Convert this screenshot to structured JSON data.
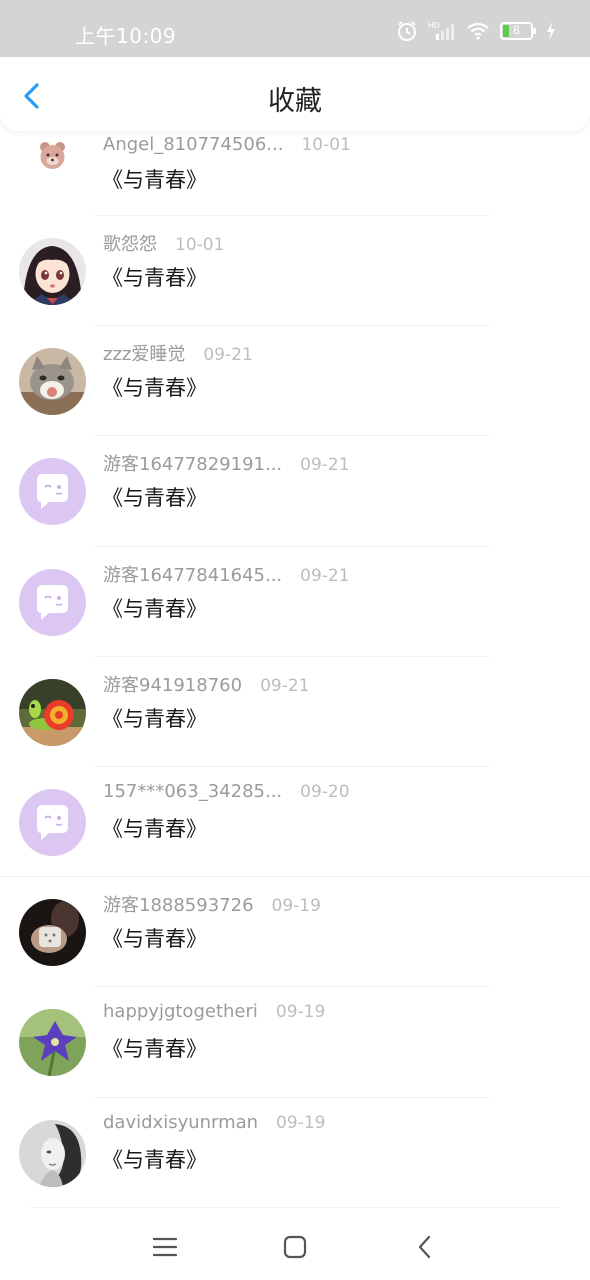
{
  "status": {
    "time": "上午10:09",
    "hd": "HD",
    "battery": "8"
  },
  "header": {
    "title": "收藏"
  },
  "items": [
    {
      "user": "Angel_810774506...",
      "date": "10-01",
      "title": "《与青春》",
      "avatar": "bear"
    },
    {
      "user": "歌怨怨",
      "date": "10-01",
      "title": "《与青春》",
      "avatar": "anime-girl"
    },
    {
      "user": "zzz爱睡觉",
      "date": "09-21",
      "title": "《与青春》",
      "avatar": "cat"
    },
    {
      "user": "游客16477829191...",
      "date": "09-21",
      "title": "《与青春》",
      "avatar": "default-chat"
    },
    {
      "user": "游客16477841645...",
      "date": "09-21",
      "title": "《与青春》",
      "avatar": "default-chat"
    },
    {
      "user": "游客941918760",
      "date": "09-21",
      "title": "《与青春》",
      "avatar": "snail"
    },
    {
      "user": "157***063_34285...",
      "date": "09-20",
      "title": "《与青春》",
      "avatar": "default-chat"
    },
    {
      "user": "游客1888593726",
      "date": "09-19",
      "title": "《与青春》",
      "avatar": "hand-photo"
    },
    {
      "user": "happyjgtogetheri",
      "date": "09-19",
      "title": "《与青春》",
      "avatar": "flower"
    },
    {
      "user": "davidxisyunrman",
      "date": "09-19",
      "title": "《与青春》",
      "avatar": "bw-portrait"
    }
  ],
  "colors": {
    "accent": "#2b9bf4",
    "default_avatar": "#dcc7f2"
  }
}
